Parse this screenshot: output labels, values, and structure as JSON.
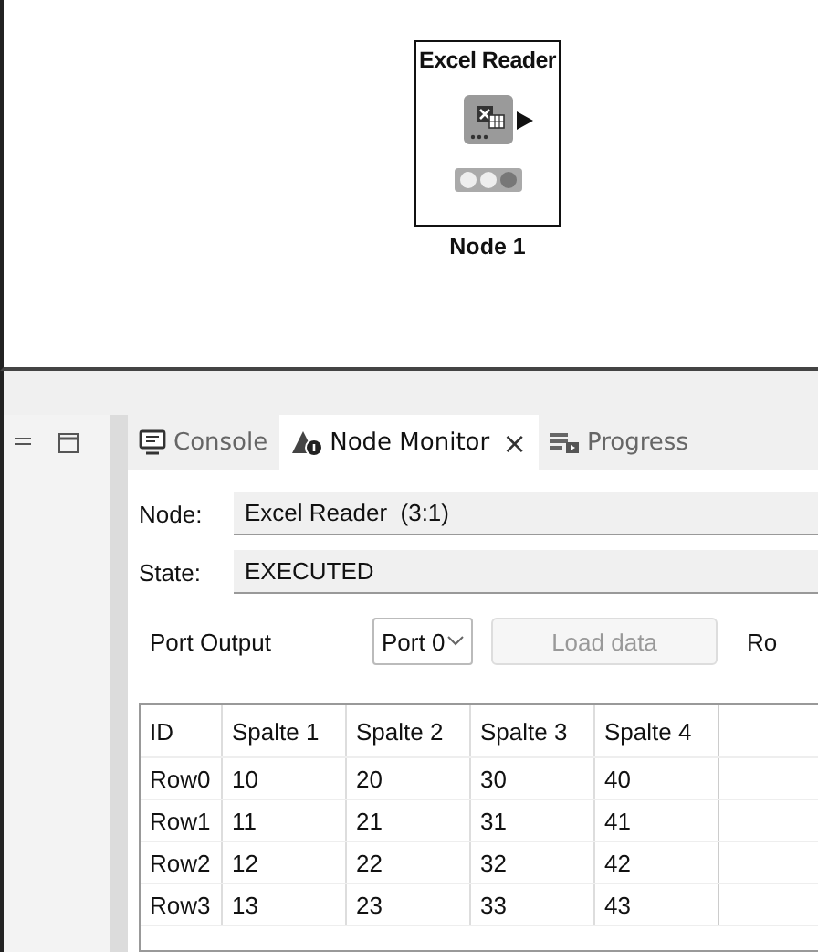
{
  "canvas": {
    "node": {
      "title": "Excel Reader",
      "label": "Node 1",
      "status_lights": [
        {
          "lit": false
        },
        {
          "lit": false
        },
        {
          "lit": true
        }
      ]
    }
  },
  "tabs": [
    {
      "label": "Console",
      "kind": "console",
      "selected": false,
      "closable": false
    },
    {
      "label": "Node Monitor",
      "kind": "monitor",
      "selected": true,
      "closable": true,
      "close": "×"
    },
    {
      "label": "Progress",
      "kind": "progress",
      "selected": false,
      "closable": false
    }
  ],
  "node_field": {
    "label": "Node:",
    "value": "Excel Reader  (3:1)"
  },
  "state_field": {
    "label": "State:",
    "value": "EXECUTED"
  },
  "port_output": {
    "label": "Port Output",
    "select": "Port 0",
    "button": {
      "label": "Load data",
      "disabled": true
    },
    "cut_label": "Ro"
  },
  "table": {
    "columns": [
      "ID",
      "Spalte 1",
      "Spalte 2",
      "Spalte 3",
      "Spalte 4"
    ],
    "rows": [
      [
        "Row0",
        "10",
        "20",
        "30",
        "40"
      ],
      [
        "Row1",
        "11",
        "21",
        "31",
        "41"
      ],
      [
        "Row2",
        "12",
        "22",
        "32",
        "42"
      ],
      [
        "Row3",
        "13",
        "23",
        "33",
        "43"
      ]
    ]
  }
}
